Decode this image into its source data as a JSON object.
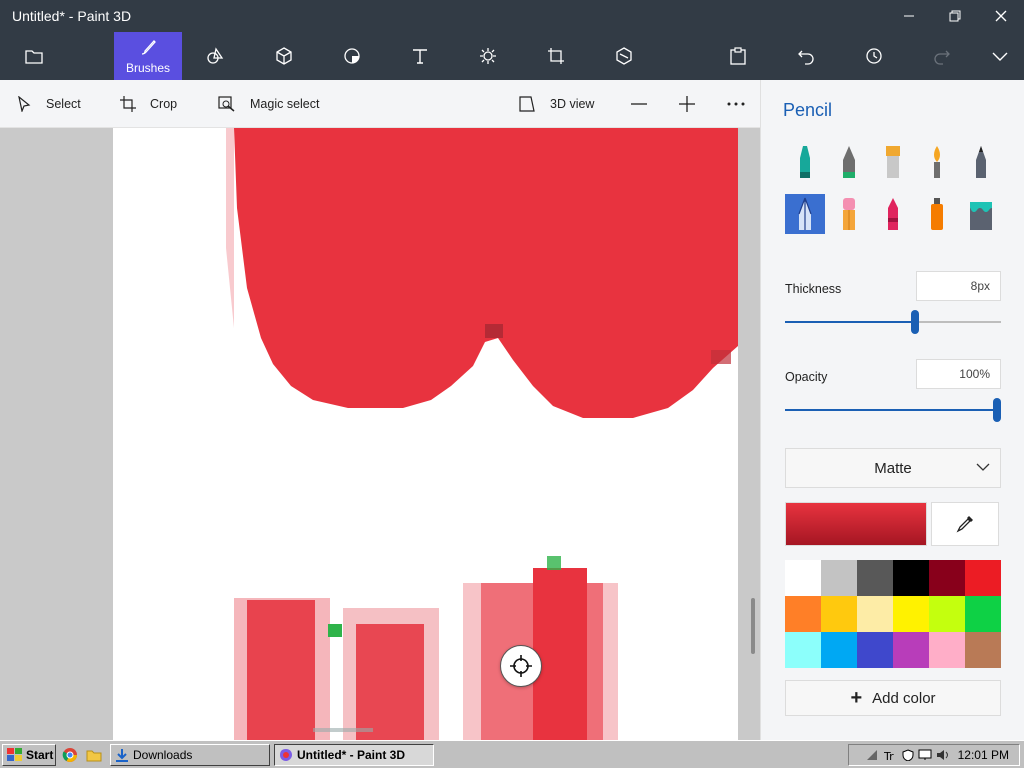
{
  "window": {
    "title": "Untitled* - Paint 3D"
  },
  "ribbon": {
    "active_tab_label": "Brushes",
    "tools": [
      "menu-icon",
      "brushes-icon",
      "2d-shapes-icon",
      "3d-shapes-icon",
      "stickers-icon",
      "text-icon",
      "effects-icon",
      "canvas-icon",
      "3d-library-icon",
      "paste-icon",
      "undo-icon",
      "history-icon",
      "redo-icon",
      "expand-icon"
    ]
  },
  "subtoolbar": {
    "select": "Select",
    "crop": "Crop",
    "magic_select": "Magic select",
    "view_3d": "3D view"
  },
  "panel": {
    "title": "Pencil",
    "thickness_label": "Thickness",
    "thickness_value": "8px",
    "thickness_level": 0.6,
    "opacity_label": "Opacity",
    "opacity_value": "100%",
    "opacity_level": 1.0,
    "finish": "Matte",
    "current_color": "#e8333f",
    "add_color_label": "Add color",
    "palette": [
      "#ffffff",
      "#c3c3c3",
      "#585858",
      "#000000",
      "#88001b",
      "#ec1c24",
      "#ff7f27",
      "#ffc90e",
      "#fdeca6",
      "#fff200",
      "#c4ff0e",
      "#0ed145",
      "#8cfffb",
      "#00a8f3",
      "#3f48cc",
      "#b83dba",
      "#ffaec8",
      "#b97a56"
    ],
    "accent_color": "#1a5fb4"
  },
  "taskbar": {
    "start": "Start",
    "downloads": "Downloads",
    "paint3d": "Untitled* - Paint 3D",
    "clock": "12:01 PM"
  }
}
